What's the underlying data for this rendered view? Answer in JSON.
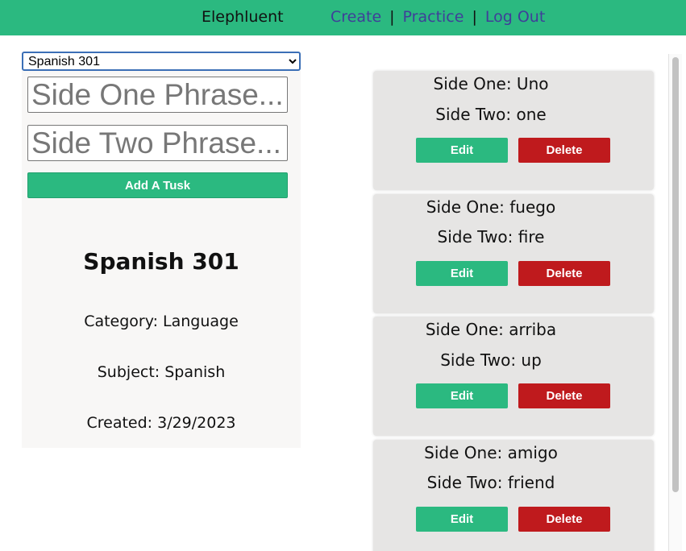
{
  "navbar": {
    "brand": "Elephluent",
    "links": {
      "create": "Create",
      "practice": "Practice",
      "logout": "Log Out"
    },
    "separator": "|",
    "color": "#2bb980"
  },
  "editor": {
    "select": {
      "selected": "Spanish 301"
    },
    "side_one_placeholder": "Side One Phrase...",
    "side_two_placeholder": "Side Two Phrase...",
    "add_label": "Add A Tusk",
    "set_title": "Spanish 301",
    "category": "Category: Language",
    "subject": "Subject: Spanish",
    "created": "Created: 3/29/2023"
  },
  "cards": [
    {
      "side_one": "Side One: Uno",
      "side_two": "Side Two: one",
      "edit": "Edit",
      "delete": "Delete"
    },
    {
      "side_one": "Side One: fuego",
      "side_two": "Side Two: fire",
      "edit": "Edit",
      "delete": "Delete"
    },
    {
      "side_one": "Side One: arriba",
      "side_two": "Side Two: up",
      "edit": "Edit",
      "delete": "Delete"
    },
    {
      "side_one": "Side One: amigo",
      "side_two": "Side Two: friend",
      "edit": "Edit",
      "delete": "Delete"
    }
  ],
  "colors": {
    "accent": "#2bb980",
    "danger": "#bf1a1d",
    "link": "#3f3f99"
  }
}
